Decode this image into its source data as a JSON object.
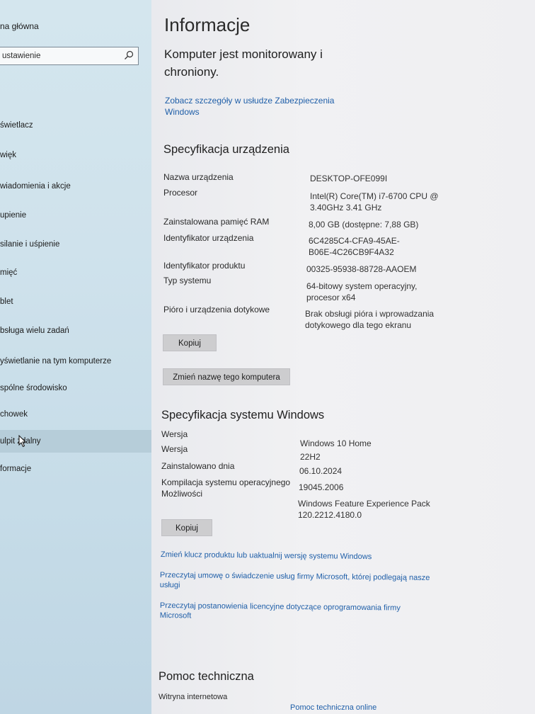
{
  "sidebar": {
    "home_label": "na główna",
    "search_placeholder": "ustawienie",
    "items": [
      {
        "label": "świetlacz"
      },
      {
        "label": "więk"
      },
      {
        "label": "wiadomienia i akcje"
      },
      {
        "label": "upienie"
      },
      {
        "label": "silanie i uśpienie"
      },
      {
        "label": "mięć"
      },
      {
        "label": "blet"
      },
      {
        "label": "bsługa wielu zadań"
      },
      {
        "label": "yświetlanie na tym komputerze"
      },
      {
        "label": "spólne środowisko"
      },
      {
        "label": "chowek"
      },
      {
        "label": "ulpit zdalny"
      },
      {
        "label": "formacje"
      }
    ]
  },
  "main": {
    "title": "Informacje",
    "status_text": "Komputer jest monitorowany i chroniony.",
    "security_link": "Zobacz szczegóły w usłudze Zabezpieczenia Windows",
    "device_spec": {
      "heading": "Specyfikacja urządzenia",
      "rows": [
        {
          "label": "Nazwa urządzenia",
          "value": "DESKTOP-OFE099I"
        },
        {
          "label": "Procesor",
          "value": "Intel(R) Core(TM) i7-6700 CPU @ 3.40GHz   3.41 GHz"
        },
        {
          "label": "Zainstalowana pamięć RAM",
          "value": "8,00 GB (dostępne: 7,88 GB)"
        },
        {
          "label": "Identyfikator urządzenia",
          "value": "6C4285C4-CFA9-45AE-B06E-4C26CB9F4A32"
        },
        {
          "label": "Identyfikator produktu",
          "value": "00325-95938-88728-AAOEM"
        },
        {
          "label": "Typ systemu",
          "value": "64-bitowy system operacyjny, procesor x64"
        },
        {
          "label": "Pióro i urządzenia dotykowe",
          "value": "Brak obsługi pióra i wprowadzania dotykowego dla tego ekranu"
        }
      ],
      "copy_button": "Kopiuj",
      "rename_button": "Zmień nazwę tego komputera"
    },
    "windows_spec": {
      "heading": "Specyfikacja systemu Windows",
      "rows": [
        {
          "label": "Wersja",
          "value": "Windows 10 Home"
        },
        {
          "label": "Wersja",
          "value": "22H2"
        },
        {
          "label": "Zainstalowano dnia",
          "value": "06.10.2024"
        },
        {
          "label": "Kompilacja systemu operacyjnego",
          "value": "19045.2006"
        },
        {
          "label": "Możliwości",
          "value": "Windows Feature Experience Pack 120.2212.4180.0"
        }
      ],
      "copy_button": "Kopiuj"
    },
    "links": {
      "product_key": "Zmień klucz produktu lub uaktualnij wersję systemu Windows",
      "services_agreement": "Przeczytaj umowę o świadczenie usług firmy Microsoft, której podlegają nasze usługi",
      "license_terms": "Przeczytaj postanowienia licencyjne dotyczące oprogramowania firmy Microsoft"
    },
    "support": {
      "heading": "Pomoc techniczna",
      "website_label": "Witryna internetowa",
      "website_value": "Pomoc techniczna online"
    }
  },
  "colors": {
    "link": "#1e5ea8",
    "sidebar_bg": "#cfe2ec",
    "button_bg": "#cdcdcf"
  }
}
